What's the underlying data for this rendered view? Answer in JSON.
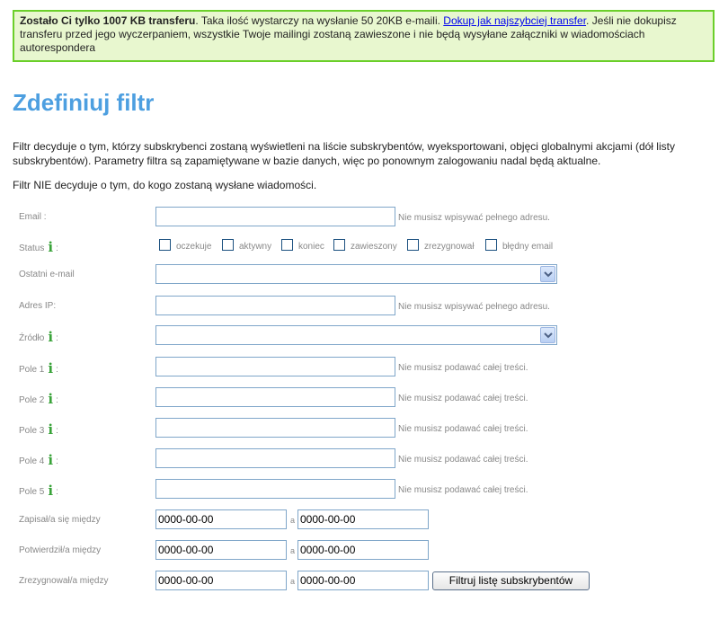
{
  "notice": {
    "bold": "Zostało Ci tylko 1007 KB transferu",
    "text1": ". Taka ilość wystarczy na wysłanie 50 20KB e-maili. ",
    "link": "Dokup jak najszybciej transfer",
    "text2": ". Jeśli nie dokupisz transferu przed jego wyczerpaniem, wszystkie Twoje mailingi zostaną zawieszone i nie będą wysyłane załączniki w wiadomościach autorespondera"
  },
  "title": "Zdefiniuj filtr",
  "paragraph1": "Filtr decyduje o tym, którzy subskrybenci zostaną wyświetleni na liście subskrybentów, wyeksportowani, objęci globalnymi akcjami (dół listy subskrybentów). Parametry filtra są zapamiętywane w bazie danych, więc po ponownym zalogowaniu nadal będą aktualne.",
  "paragraph2": "Filtr NIE decyduje o tym, do kogo zostaną wysłane wiadomości.",
  "info_glyph": "i",
  "fields": {
    "email_label": "Email :",
    "email_hint": "Nie musisz wpisywać pełnego adresu.",
    "status_label": "Status",
    "colon": ":",
    "status_options": [
      "oczekuje",
      "aktywny",
      "koniec",
      "zawieszony",
      "zrezygnował",
      "błędny email"
    ],
    "last_email_label": "Ostatni e-mail",
    "ip_label": "Adres IP:",
    "ip_hint": "Nie musisz wpisywać pełnego adresu.",
    "source_label": "Źródło",
    "field1_label": "Pole 1",
    "field2_label": "Pole 2",
    "field3_label": "Pole 3",
    "field4_label": "Pole 4",
    "field5_label": "Pole 5",
    "field_hint": "Nie musisz podawać całej treści.",
    "signup_label": "Zapisał/a się między",
    "confirm_label": "Potwierdził/a między",
    "resign_label": "Zrezygnował/a między",
    "date_placeholder": "0000-00-00",
    "separator": "a"
  },
  "button": "Filtruj listę subskrybentów"
}
